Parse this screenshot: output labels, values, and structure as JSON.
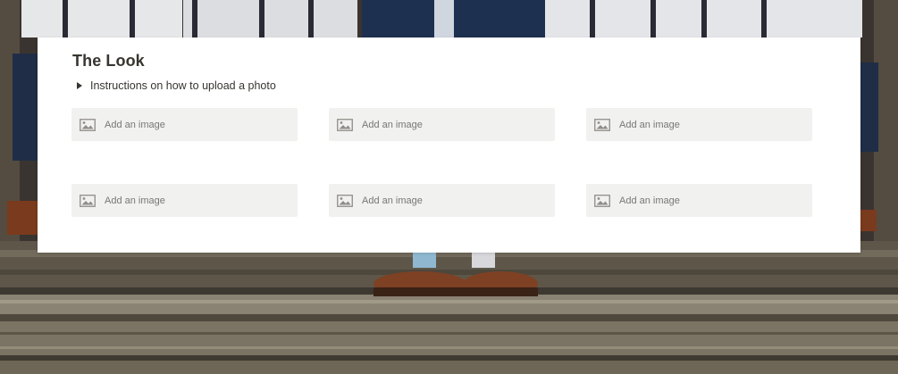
{
  "page": {
    "title": "The Look",
    "instructions_toggle": "Instructions on how to upload a photo"
  },
  "gallery": {
    "slots": [
      {
        "label": "Add an image",
        "icon": "image-icon"
      },
      {
        "label": "Add an image",
        "icon": "image-icon"
      },
      {
        "label": "Add an image",
        "icon": "image-icon"
      },
      {
        "label": "Add an image",
        "icon": "image-icon"
      },
      {
        "label": "Add an image",
        "icon": "image-icon"
      },
      {
        "label": "Add an image",
        "icon": "image-icon"
      }
    ]
  },
  "colors": {
    "card_bg": "#ffffff",
    "slot_bg": "#f1f1ef",
    "text": "#37352f",
    "muted_text": "#787774"
  }
}
